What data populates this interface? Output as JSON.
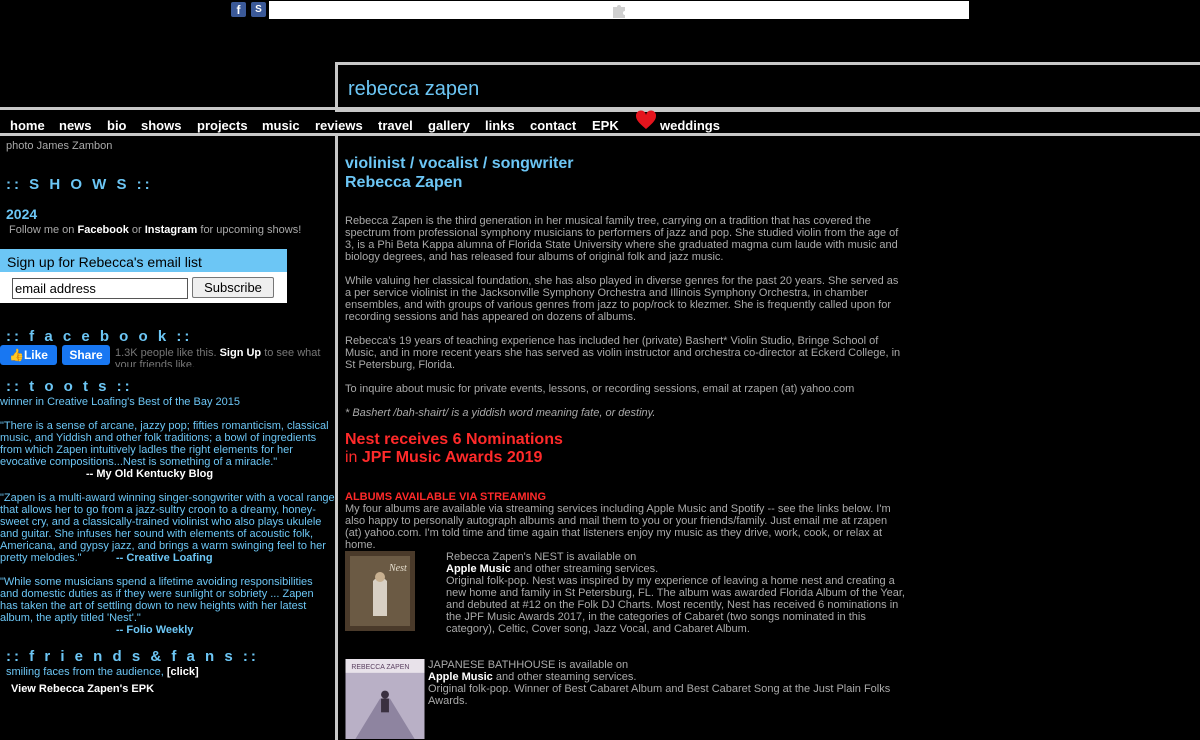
{
  "topbar": {
    "fb_glyph": "f",
    "share_glyph": "S"
  },
  "site_title": "rebecca zapen",
  "nav": {
    "items": [
      "home",
      "news",
      "bio",
      "shows",
      "projects",
      "music",
      "reviews",
      "travel",
      "gallery",
      "links",
      "contact",
      "EPK",
      "weddings"
    ]
  },
  "left": {
    "photo_credit": "photo James Zambon",
    "shows_heading": ":: S H O W S ::",
    "shows_year": "2024",
    "follow_prefix": "Follow me on ",
    "follow_facebook": "Facebook",
    "follow_or": " or ",
    "follow_instagram": "Instagram",
    "follow_suffix": " for upcoming shows!",
    "email_heading": "Sign up for Rebecca's email list",
    "email_value": "email address",
    "subscribe_label": "Subscribe",
    "facebook_heading": ":: f a c e b o o k ::",
    "like_label": "Like",
    "share_label": "Share",
    "like_count_text": "1.3K people like this.",
    "signup_link": "Sign Up",
    "signup_suffix": " to see what your friends like.",
    "toots_heading": ":: t o o t s ::",
    "toot_award": "winner in Creative Loafing's Best of the Bay 2015",
    "quotes": [
      {
        "text": "\"There is a sense of arcane, jazzy pop; fifties romanticism, classical music, and Yiddish and other folk traditions; a bowl of ingredients from which Zapen intuitively ladles the right elements for her evocative compositions...Nest is something of a miracle.\"",
        "source": "-- My Old Kentucky Blog"
      },
      {
        "text": "\"Zapen is a multi-award winning singer-songwriter with a vocal range that allows her to go from a jazz-sultry croon to a dreamy, honey-sweet cry, and a classically-trained violinist who also plays ukulele and guitar. She infuses her sound with elements of acoustic folk, Americana, and gypsy jazz, and brings a warm swinging feel to her pretty melodies.\"",
        "source": "-- Creative Loafing"
      },
      {
        "text": "\"While some musicians spend a lifetime avoiding responsibilities and domestic duties as if they were sunlight or sobriety ... Zapen has taken the art of settling down to new heights with her latest album, the aptly titled 'Nest'.\"",
        "source": "-- Folio Weekly"
      }
    ],
    "friends_heading": ":: f r i e n d s  &  f a n s ::",
    "friends_text": "smiling faces from the audience, ",
    "friends_link": "[click]",
    "epk_link": "View Rebecca Zapen's EPK"
  },
  "main": {
    "tagline": "violinist / vocalist / songwriter",
    "name": "Rebecca Zapen",
    "para1": "Rebecca Zapen is the third generation in her musical family tree, carrying on a tradition that has covered the spectrum from professional symphony musicians to performers of jazz and pop. She studied violin from the age of 3, is a Phi Beta Kappa alumna of Florida State University where she graduated magma cum laude with music and biology degrees, and has released four albums of original folk and jazz music.",
    "para2": "While valuing her classical foundation, she has also played in diverse genres for the past 20 years. She served as a per service violinist in the Jacksonville Symphony Orchestra and Illinois Symphony Orchestra, in chamber ensembles, and with groups of various genres from jazz to pop/rock to klezmer. She is frequently called upon for recording sessions and has appeared on dozens of albums.",
    "para3": "Rebecca's 19 years of teaching experience has included her (private) Bashert* Violin Studio, Bringe School of Music, and in more recent years she has served as violin instructor and orchestra co-director at Eckerd College, in St Petersburg, Florida.",
    "para4": "To inquire about music for private events, lessons, or recording sessions, email at rzapen (at) yahoo.com",
    "footnote": "* Bashert /bah-shairt/ is a yiddish word meaning fate, or destiny.",
    "nom_line1": "Nest receives 6 Nominations",
    "nom_in": "in ",
    "nom_line2": "JPF Music Awards 2019",
    "streaming_heading": "ALBUMS AVAILABLE VIA STREAMING",
    "streaming_text": "My four albums are available via streaming services including Apple Music and Spotify -- see the links below. I'm also happy to personally autograph albums and mail them to you or your friends/family. Just email me at rzapen (at) yahoo.com. I'm told time and time again that listeners enjoy my music as they drive, work, cook, or relax at home.",
    "albums": [
      {
        "avail": "Rebecca Zapen's NEST is available on",
        "link": "Apple Music",
        "services": " and other streaming services.",
        "desc": "Original folk-pop. Nest was inspired by my experience of leaving a home nest and creating a new home and family in St Petersburg, FL. The album was awarded Florida Album of the Year, and debuted at #12 on the Folk DJ Charts. Most recently, Nest has received 6 nominations in the JPF Music Awards 2017, in the categories of Cabaret (two songs nominated in this category), Celtic, Cover song, Jazz Vocal, and Cabaret Album.",
        "cover_text": "Nest"
      },
      {
        "avail": "JAPANESE BATHHOUSE is available on",
        "link": "Apple Music",
        "services": " and other steaming services.",
        "desc": "Original folk-pop. Winner of Best Cabaret Album and Best Cabaret Song at the Just Plain Folks Awards.",
        "cover_text": "REBECCA ZAPEN"
      }
    ]
  },
  "colors": {
    "accent_blue": "#6cc6f5",
    "alert_red": "#ff2a2a",
    "frame_gray": "#c8c8c8"
  }
}
